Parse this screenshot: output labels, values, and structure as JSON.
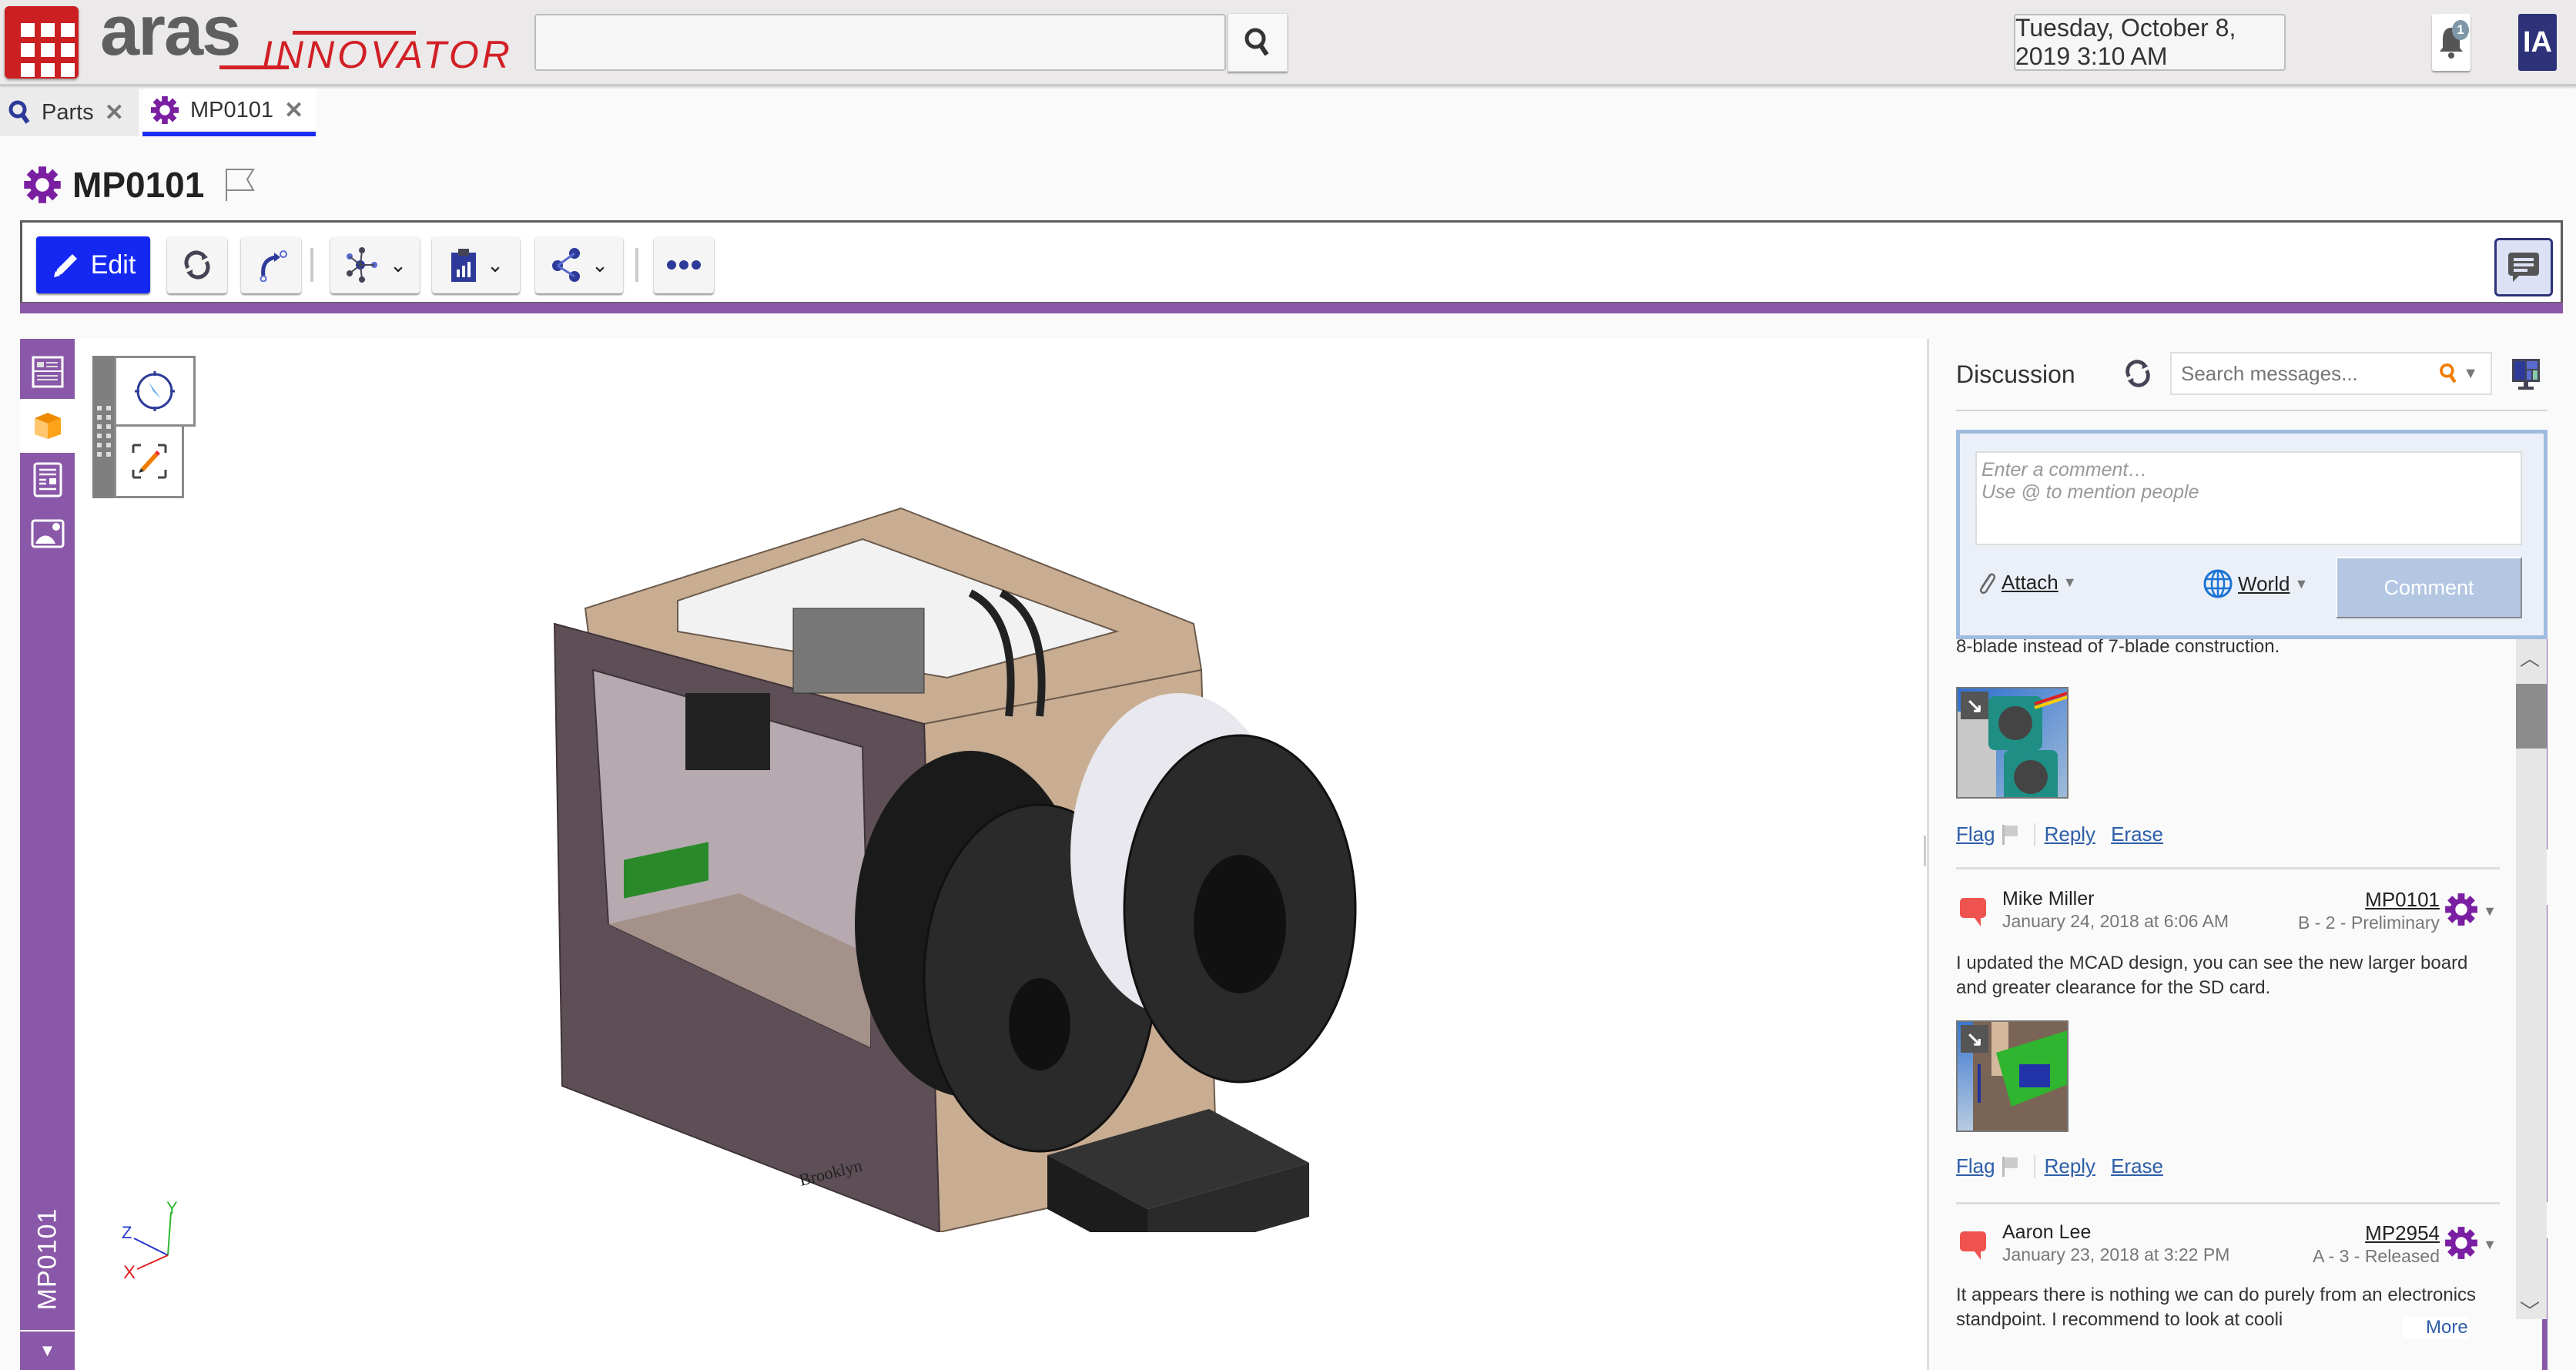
{
  "header": {
    "logo_brand": "aras",
    "logo_product": "INNOVATOR",
    "search_placeholder": "",
    "datetime": "Tuesday, October 8, 2019 3:10 AM",
    "notification_count": "1",
    "user_initials": "IA",
    "colors": {
      "brand_red": "#cc1f22",
      "user_badge": "#2d3279"
    }
  },
  "tabs": [
    {
      "label": "Parts",
      "icon": "search-icon",
      "active": false
    },
    {
      "label": "MP0101",
      "icon": "part-gear-icon",
      "active": true
    }
  ],
  "title": {
    "text": "MP0101",
    "icon": "part-gear-icon",
    "flag_icon": "flag-outline-icon"
  },
  "toolbar": {
    "edit_label": "Edit",
    "buttons": [
      {
        "name": "refresh",
        "icon": "refresh-icon"
      },
      {
        "name": "promote",
        "icon": "lifecycle-promote-icon"
      },
      {
        "name": "structure",
        "icon": "structure-network-icon",
        "dropdown": true
      },
      {
        "name": "reports",
        "icon": "report-clipboard-icon",
        "dropdown": true
      },
      {
        "name": "share",
        "icon": "share-icon",
        "dropdown": true
      },
      {
        "name": "more",
        "icon": "more-horizontal-icon"
      }
    ],
    "discussion_toggle_icon": "chat-icon",
    "accent_color": "#8a58a8"
  },
  "sidebar": {
    "items": [
      {
        "name": "form-view",
        "icon": "form-icon"
      },
      {
        "name": "3d-view",
        "icon": "cube-icon",
        "active": true
      },
      {
        "name": "relationships",
        "icon": "document-icon"
      },
      {
        "name": "image-view",
        "icon": "image-icon"
      }
    ],
    "vertical_label": "MP0101"
  },
  "viewer": {
    "tools": [
      "navigation-compass-icon",
      "markup-pencil-icon"
    ],
    "axes": {
      "x": "X",
      "y": "Y",
      "z": "Z"
    },
    "model_caption": "Brooklyn"
  },
  "discussion": {
    "title": "Discussion",
    "search_placeholder": "Search messages...",
    "compose": {
      "placeholder": "Enter a comment…\nUse @ to mention people",
      "attach_label": "Attach",
      "visibility_label": "World",
      "comment_button": "Comment"
    },
    "messages": [
      {
        "text": "8-blade instead of 7-blade construction.",
        "has_thumbnail": true,
        "actions": {
          "flag": "Flag",
          "reply": "Reply",
          "erase": "Erase"
        }
      },
      {
        "author": "Mike Miller",
        "date": "January 24, 2018 at 6:06 AM",
        "item_ref": "MP0101",
        "item_state": "B - 2 - Preliminary",
        "text": "I updated the MCAD design, you can see the new larger board and greater clearance for the SD card.",
        "has_thumbnail": true,
        "actions": {
          "flag": "Flag",
          "reply": "Reply",
          "erase": "Erase"
        }
      },
      {
        "author": "Aaron Lee",
        "date": "January 23, 2018 at 3:22 PM",
        "item_ref": "MP2954",
        "item_state": "A - 3 - Released",
        "text": "It appears there is nothing we can do purely from an electronics standpoint.  I recommend to look at cooli",
        "more_label": "More"
      }
    ]
  }
}
